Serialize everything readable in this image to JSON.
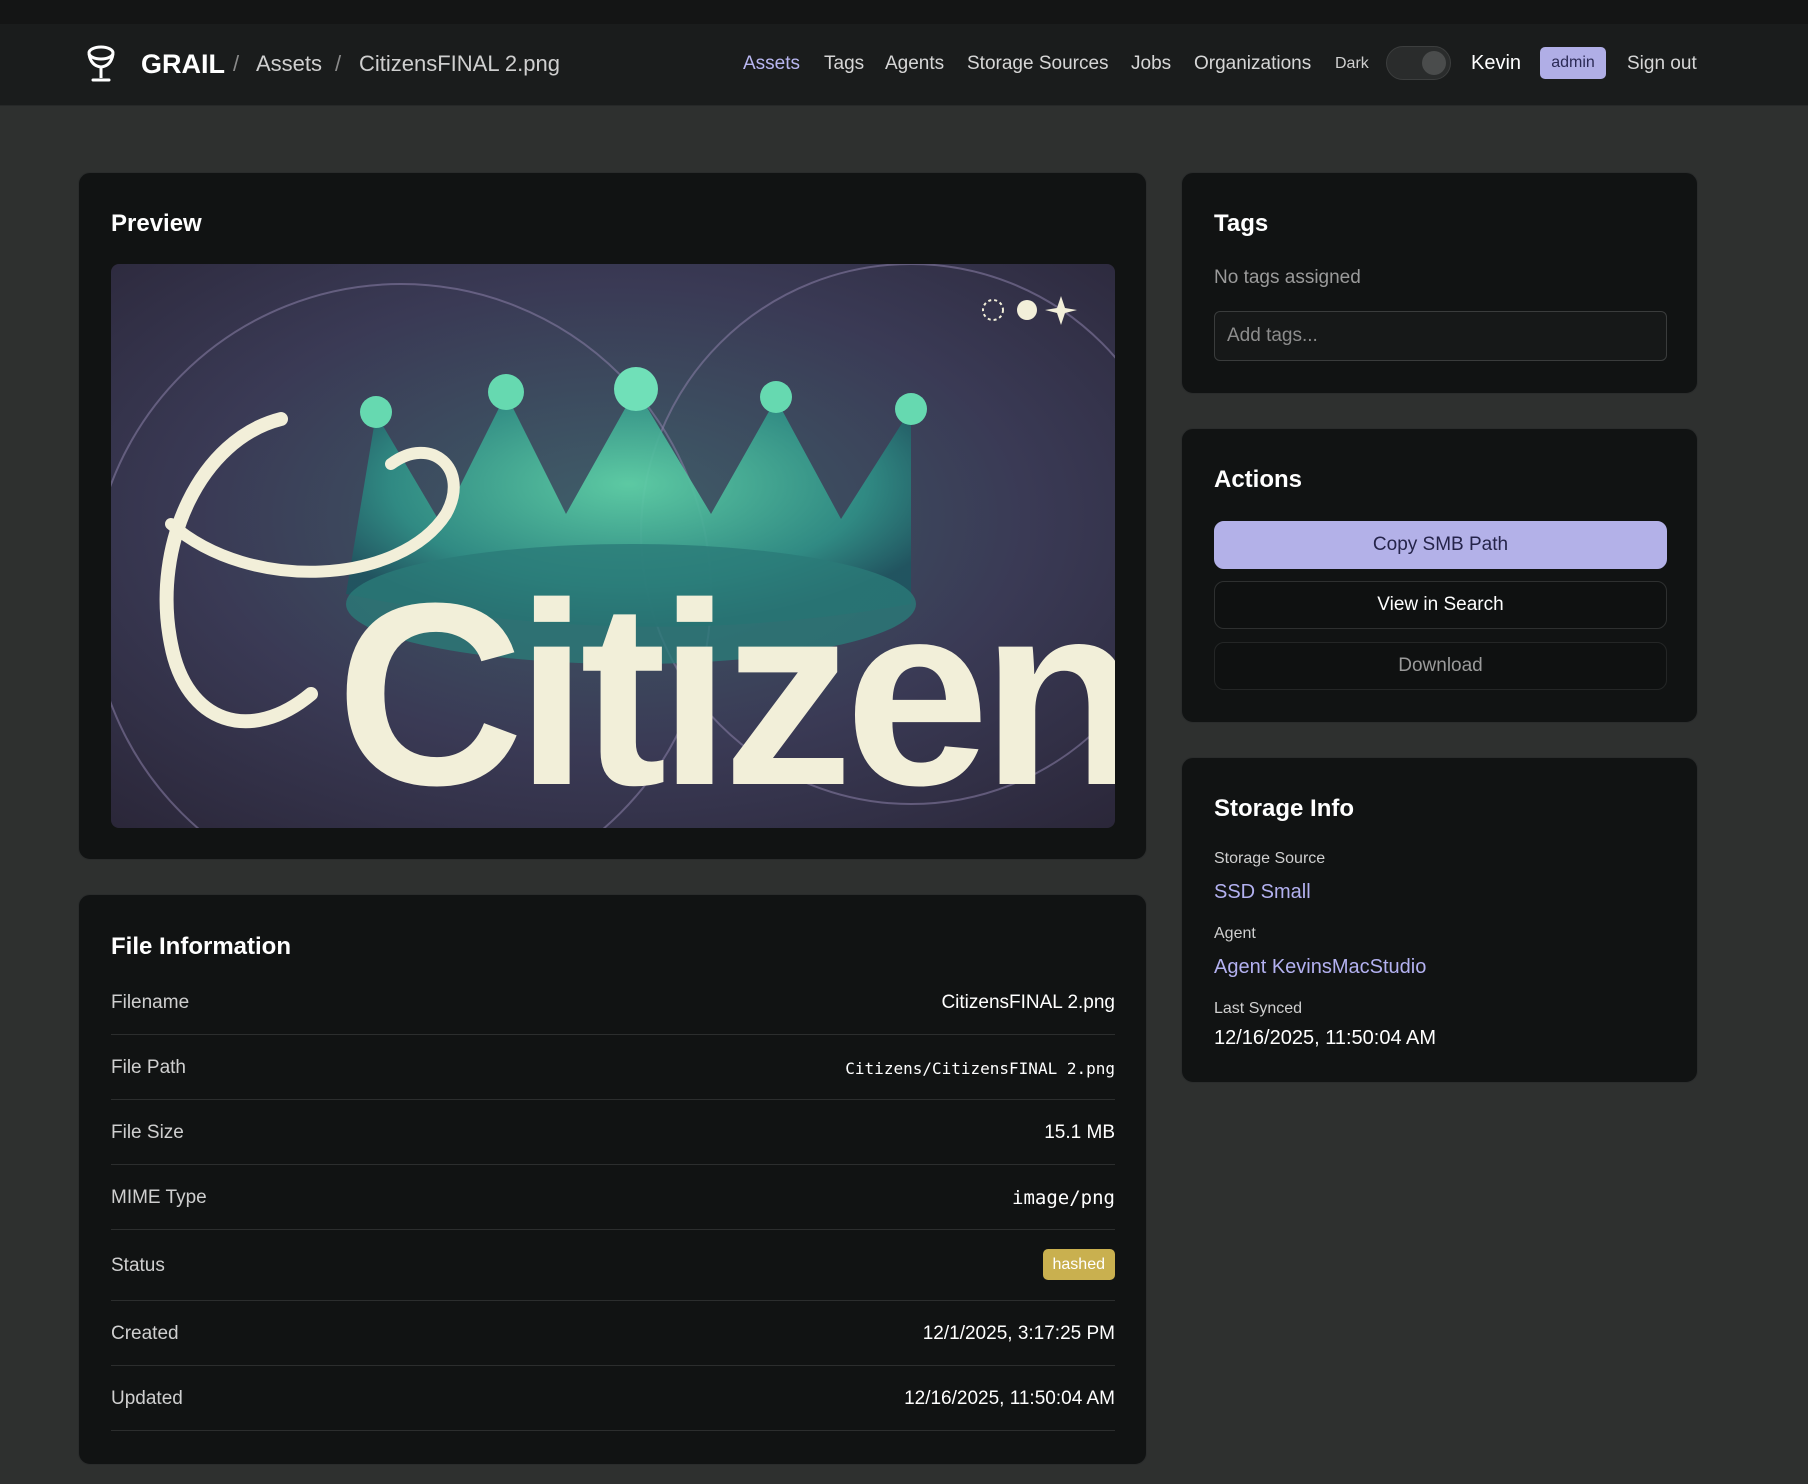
{
  "header": {
    "app_name": "GRAIL",
    "breadcrumb": [
      "Assets",
      "CitizensFINAL 2.png"
    ],
    "separator": "/",
    "nav": [
      "Assets",
      "Tags",
      "Agents",
      "Storage Sources",
      "Jobs",
      "Organizations"
    ],
    "active_nav": "Assets",
    "theme_label": "Dark",
    "user": "Kevin",
    "role_badge": "admin",
    "sign_out": "Sign out"
  },
  "preview": {
    "title": "Preview",
    "image_text": "Citizens"
  },
  "file_info": {
    "title": "File Information",
    "rows": [
      {
        "label": "Filename",
        "value": "CitizensFINAL 2.png"
      },
      {
        "label": "File Path",
        "value": "Citizens/CitizensFINAL 2.png"
      },
      {
        "label": "File Size",
        "value": "15.1 MB"
      },
      {
        "label": "MIME Type",
        "value": "image/png"
      },
      {
        "label": "Status",
        "value": "hashed"
      },
      {
        "label": "Created",
        "value": "12/1/2025, 3:17:25 PM"
      },
      {
        "label": "Updated",
        "value": "12/16/2025, 11:50:04 AM"
      }
    ]
  },
  "tags": {
    "title": "Tags",
    "empty_text": "No tags assigned",
    "input_placeholder": "Add tags..."
  },
  "actions": {
    "title": "Actions",
    "copy_smb": "Copy SMB Path",
    "view_search": "View in Search",
    "download": "Download"
  },
  "storage_info": {
    "title": "Storage Info",
    "source_label": "Storage Source",
    "source_value": "SSD Small",
    "agent_label": "Agent",
    "agent_value": "Agent KevinsMacStudio",
    "synced_label": "Last Synced",
    "synced_value": "12/16/2025, 11:50:04 AM"
  },
  "colors": {
    "accent": "#b3b1e8",
    "status_hashed": "#c9b04f",
    "card_bg": "#111313",
    "page_bg": "#2e302f"
  },
  "icons": {
    "brand": "chalice-icon"
  }
}
